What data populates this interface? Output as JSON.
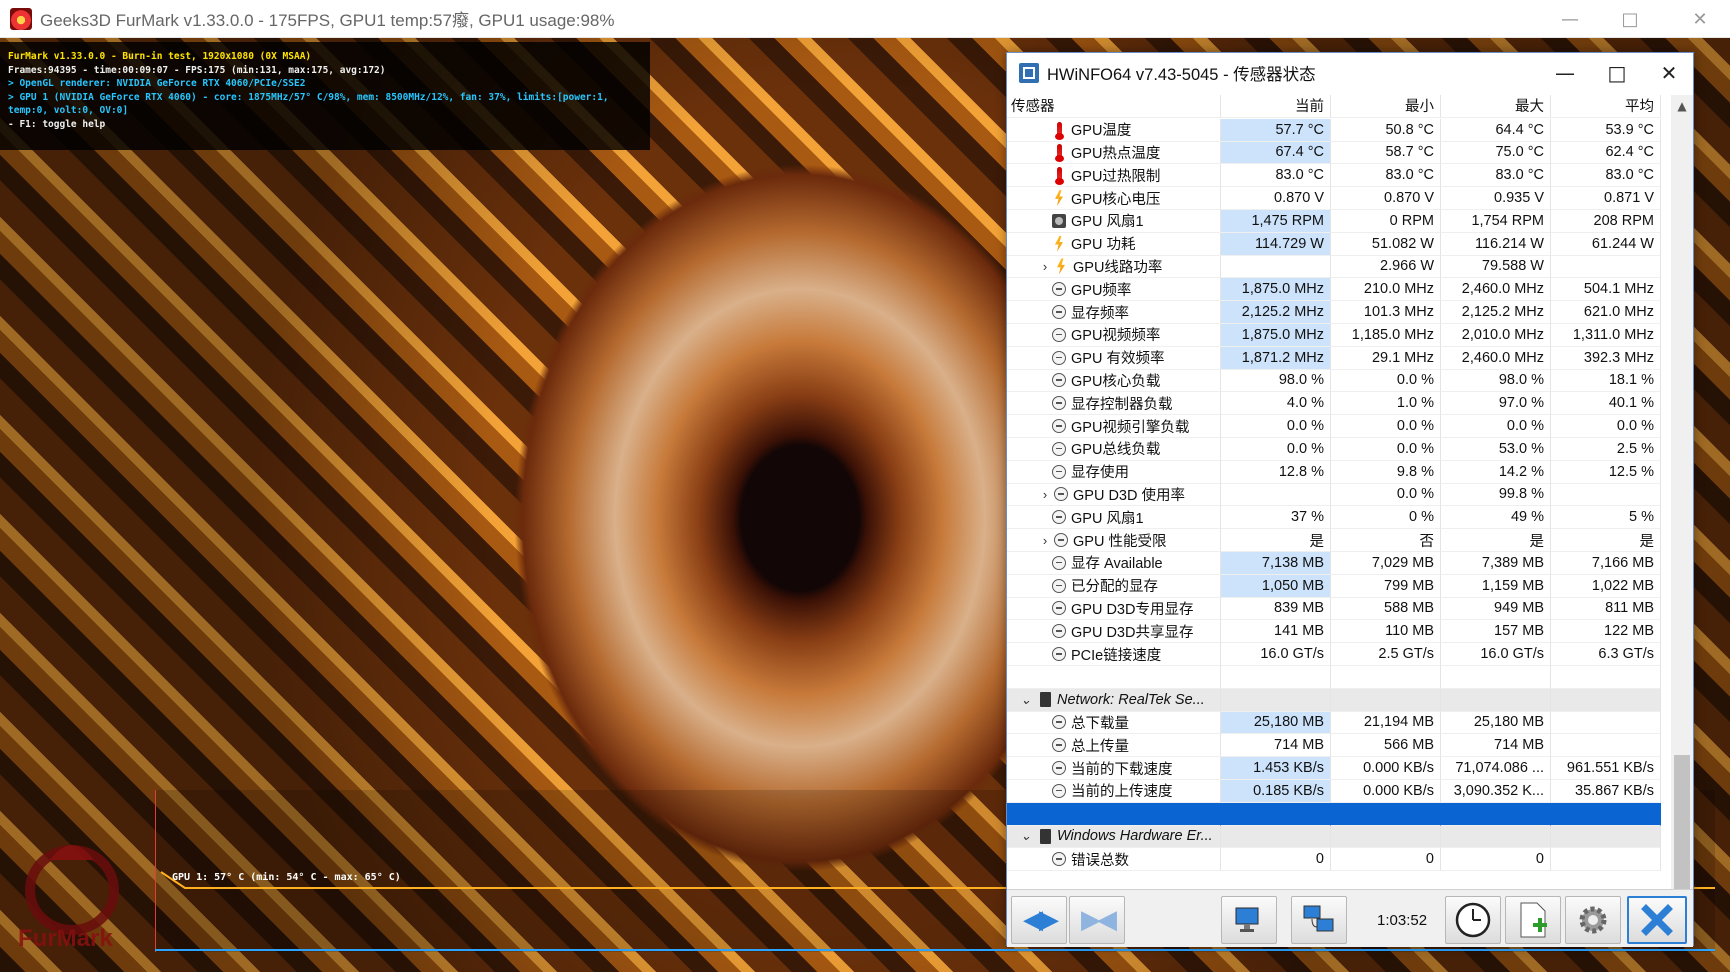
{
  "furmark": {
    "title": "Geeks3D FurMark v1.33.0.0 - 175FPS, GPU1 temp:57癈, GPU1 usage:98%",
    "osd": [
      {
        "text": "FurMark v1.33.0.0 - Burn-in test, 1920x1080 (0X MSAA)",
        "color": "yellow"
      },
      {
        "text": "Frames:94395 - time:00:09:07 - FPS:175 (min:131, max:175, avg:172)",
        "color": "white"
      },
      {
        "text": "> OpenGL renderer: NVIDIA GeForce RTX 4060/PCIe/SSE2",
        "color": "cyan"
      },
      {
        "text": "> GPU 1 (NVIDIA GeForce RTX 4060) - core: 1875MHz/57° C/98%, mem: 8500MHz/12%, fan: 37%, limits:[power:1, temp:0, volt:0, OV:0]",
        "color": "cyan"
      },
      {
        "text": "- F1: toggle help",
        "color": "white"
      }
    ],
    "graph_label": "GPU 1: 57° C (min: 54° C - max: 65° C)",
    "logo_text": "FurMark"
  },
  "hwinfo": {
    "title": "HWiNFO64 v7.43-5045 - 传感器状态",
    "columns": [
      "传感器",
      "当前",
      "最小",
      "最大",
      "平均"
    ],
    "rows": [
      {
        "icon": "temp",
        "name": "GPU温度",
        "cur": "57.7 °C",
        "min": "50.8 °C",
        "max": "64.4 °C",
        "avg": "53.9 °C",
        "hl": true
      },
      {
        "icon": "temp",
        "name": "GPU热点温度",
        "cur": "67.4 °C",
        "min": "58.7 °C",
        "max": "75.0 °C",
        "avg": "62.4 °C",
        "hl": true
      },
      {
        "icon": "temp",
        "name": "GPU过热限制",
        "cur": "83.0 °C",
        "min": "83.0 °C",
        "max": "83.0 °C",
        "avg": "83.0 °C",
        "hl": false
      },
      {
        "icon": "bolt",
        "name": "GPU核心电压",
        "cur": "0.870 V",
        "min": "0.870 V",
        "max": "0.935 V",
        "avg": "0.871 V",
        "hl": false
      },
      {
        "icon": "fan",
        "name": "GPU 风扇1",
        "cur": "1,475 RPM",
        "min": "0 RPM",
        "max": "1,754 RPM",
        "avg": "208 RPM",
        "hl": true
      },
      {
        "icon": "bolt",
        "name": "GPU 功耗",
        "cur": "114.729 W",
        "min": "51.082 W",
        "max": "116.214 W",
        "avg": "61.244 W",
        "hl": true
      },
      {
        "icon": "bolt",
        "name": "GPU线路功率",
        "cur": "",
        "min": "2.966 W",
        "max": "79.588 W",
        "avg": "",
        "hl": false,
        "expand": true
      },
      {
        "icon": "clock",
        "name": "GPU频率",
        "cur": "1,875.0 MHz",
        "min": "210.0 MHz",
        "max": "2,460.0 MHz",
        "avg": "504.1 MHz",
        "hl": true
      },
      {
        "icon": "clock",
        "name": "显存频率",
        "cur": "2,125.2 MHz",
        "min": "101.3 MHz",
        "max": "2,125.2 MHz",
        "avg": "621.0 MHz",
        "hl": true
      },
      {
        "icon": "clock",
        "name": "GPU视频频率",
        "cur": "1,875.0 MHz",
        "min": "1,185.0 MHz",
        "max": "2,010.0 MHz",
        "avg": "1,311.0 MHz",
        "hl": true
      },
      {
        "icon": "clock",
        "name": "GPU 有效频率",
        "cur": "1,871.2 MHz",
        "min": "29.1 MHz",
        "max": "2,460.0 MHz",
        "avg": "392.3 MHz",
        "hl": true
      },
      {
        "icon": "clock",
        "name": "GPU核心负载",
        "cur": "98.0 %",
        "min": "0.0 %",
        "max": "98.0 %",
        "avg": "18.1 %",
        "hl": false
      },
      {
        "icon": "clock",
        "name": "显存控制器负载",
        "cur": "4.0 %",
        "min": "1.0 %",
        "max": "97.0 %",
        "avg": "40.1 %",
        "hl": false
      },
      {
        "icon": "clock",
        "name": "GPU视频引擎负载",
        "cur": "0.0 %",
        "min": "0.0 %",
        "max": "0.0 %",
        "avg": "0.0 %",
        "hl": false
      },
      {
        "icon": "clock",
        "name": "GPU总线负载",
        "cur": "0.0 %",
        "min": "0.0 %",
        "max": "53.0 %",
        "avg": "2.5 %",
        "hl": false
      },
      {
        "icon": "clock",
        "name": "显存使用",
        "cur": "12.8 %",
        "min": "9.8 %",
        "max": "14.2 %",
        "avg": "12.5 %",
        "hl": false
      },
      {
        "icon": "clock",
        "name": "GPU D3D 使用率",
        "cur": "",
        "min": "0.0 %",
        "max": "99.8 %",
        "avg": "",
        "hl": false,
        "expand": true
      },
      {
        "icon": "clock",
        "name": "GPU 风扇1",
        "cur": "37 %",
        "min": "0 %",
        "max": "49 %",
        "avg": "5 %",
        "hl": false
      },
      {
        "icon": "clock",
        "name": "GPU 性能受限",
        "cur": "是",
        "min": "否",
        "max": "是",
        "avg": "是",
        "hl": false,
        "expand": true
      },
      {
        "icon": "clock",
        "name": "显存 Available",
        "cur": "7,138 MB",
        "min": "7,029 MB",
        "max": "7,389 MB",
        "avg": "7,166 MB",
        "hl": true
      },
      {
        "icon": "clock",
        "name": "已分配的显存",
        "cur": "1,050 MB",
        "min": "799 MB",
        "max": "1,159 MB",
        "avg": "1,022 MB",
        "hl": true
      },
      {
        "icon": "clock",
        "name": "GPU D3D专用显存",
        "cur": "839 MB",
        "min": "588 MB",
        "max": "949 MB",
        "avg": "811 MB",
        "hl": false
      },
      {
        "icon": "clock",
        "name": "GPU D3D共享显存",
        "cur": "141 MB",
        "min": "110 MB",
        "max": "157 MB",
        "avg": "122 MB",
        "hl": false
      },
      {
        "icon": "clock",
        "name": "PCIe链接速度",
        "cur": "16.0 GT/s",
        "min": "2.5 GT/s",
        "max": "16.0 GT/s",
        "avg": "6.3 GT/s",
        "hl": false
      },
      {
        "type": "blank"
      },
      {
        "type": "group",
        "name": "Network: RealTek Se..."
      },
      {
        "icon": "clock",
        "name": "总下载量",
        "cur": "25,180 MB",
        "min": "21,194 MB",
        "max": "25,180 MB",
        "avg": "",
        "hl": true
      },
      {
        "icon": "clock",
        "name": "总上传量",
        "cur": "714 MB",
        "min": "566 MB",
        "max": "714 MB",
        "avg": "",
        "hl": false
      },
      {
        "icon": "clock",
        "name": "当前的下载速度",
        "cur": "1.453 KB/s",
        "min": "0.000 KB/s",
        "max": "71,074.086 ...",
        "avg": "961.551 KB/s",
        "hl": true
      },
      {
        "icon": "clock",
        "name": "当前的上传速度",
        "cur": "0.185 KB/s",
        "min": "0.000 KB/s",
        "max": "3,090.352 K...",
        "avg": "35.867 KB/s",
        "hl": true
      },
      {
        "type": "selected"
      },
      {
        "type": "group",
        "name": "Windows Hardware Er..."
      },
      {
        "icon": "clock",
        "name": "错误总数",
        "cur": "0",
        "min": "0",
        "max": "0",
        "avg": "",
        "hl": false
      }
    ],
    "elapsed": "1:03:52"
  }
}
